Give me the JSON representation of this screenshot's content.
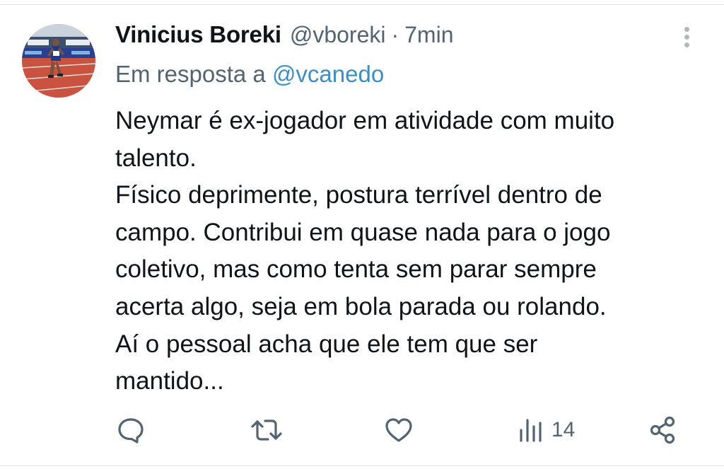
{
  "tweet": {
    "author_name": "Vinicius Boreki",
    "handle": "@vboreki",
    "separator": "·",
    "time": "7min",
    "reply_prefix": "Em resposta a",
    "reply_to": "@vcanedo",
    "text_lines": [
      "Neymar é ex-jogador em atividade com muito",
      "talento.",
      "Físico deprimente, postura terrível dentro de",
      "campo. Contribui em quase nada para o jogo",
      "coletivo, mas como tenta sem parar sempre",
      "acerta algo, seja em bola parada ou rolando.",
      "Aí o pessoal acha que ele tem que ser",
      "mantido..."
    ],
    "views": "14"
  },
  "icons": {
    "avatar": "runner-photo-avatar",
    "more": "more-vertical-icon",
    "reply": "comment-icon",
    "retweet": "retweet-icon",
    "like": "heart-icon",
    "views": "bar-chart-icon",
    "share": "share-icon"
  },
  "colors": {
    "text": "#0f1419",
    "secondary": "#536471",
    "link": "#3b8fc7",
    "icon": "#536471"
  }
}
